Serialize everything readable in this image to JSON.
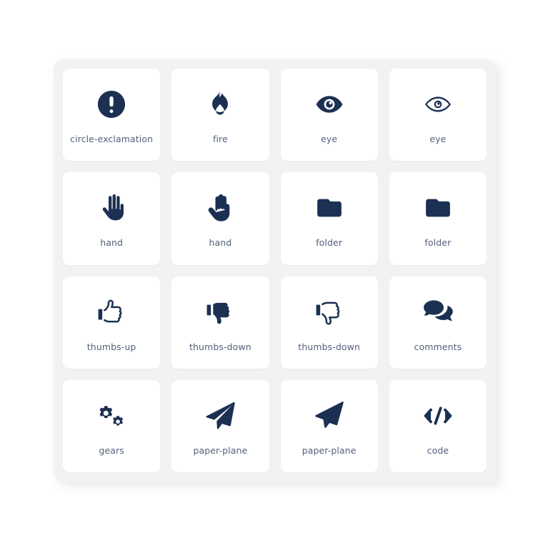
{
  "panel": {
    "background_color": "#f1f2f4",
    "card_color": "#ffffff",
    "icon_color": "#1b3053",
    "label_color": "#53607a"
  },
  "grid": {
    "columns": 4,
    "rows": 4,
    "items": [
      {
        "label": "circle-exclamation",
        "icon": "circle-exclamation-icon",
        "style": "solid"
      },
      {
        "label": "fire",
        "icon": "fire-icon",
        "style": "solid"
      },
      {
        "label": "eye",
        "icon": "eye-icon",
        "style": "solid"
      },
      {
        "label": "eye",
        "icon": "eye-icon",
        "style": "outline"
      },
      {
        "label": "hand",
        "icon": "hand-icon",
        "style": "solid"
      },
      {
        "label": "hand",
        "icon": "hand-icon",
        "style": "outline"
      },
      {
        "label": "folder",
        "icon": "folder-icon",
        "style": "solid"
      },
      {
        "label": "folder",
        "icon": "folder-icon",
        "style": "outline"
      },
      {
        "label": "thumbs-up",
        "icon": "thumbs-up-icon",
        "style": "outline"
      },
      {
        "label": "thumbs-down",
        "icon": "thumbs-down-icon",
        "style": "solid"
      },
      {
        "label": "thumbs-down",
        "icon": "thumbs-down-icon",
        "style": "outline"
      },
      {
        "label": "comments",
        "icon": "comments-icon",
        "style": "solid"
      },
      {
        "label": "gears",
        "icon": "gears-icon",
        "style": "solid"
      },
      {
        "label": "paper-plane",
        "icon": "paper-plane-icon",
        "style": "solid"
      },
      {
        "label": "paper-plane",
        "icon": "paper-plane-icon",
        "style": "outline"
      },
      {
        "label": "code",
        "icon": "code-icon",
        "style": "solid"
      }
    ]
  }
}
